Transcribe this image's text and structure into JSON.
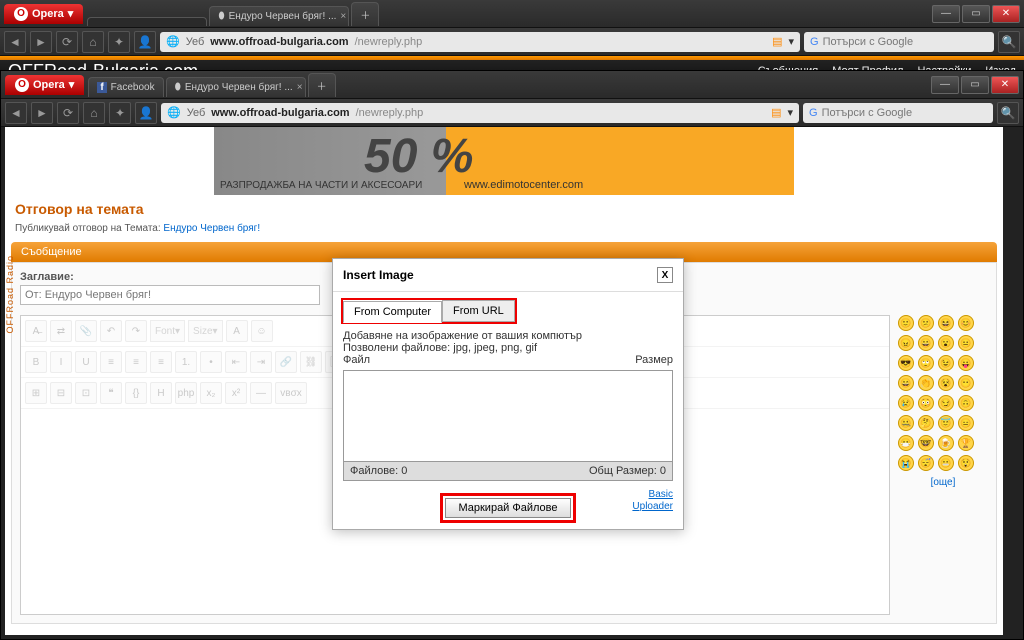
{
  "chrome": {
    "opera_label": "Opera",
    "tabs": [
      "",
      "Ендуро Червен бряг! ..."
    ],
    "addr_label": "Уеб",
    "domain": "www.offroad-bulgaria.com",
    "path": "/newreply.php",
    "search_placeholder": "Потърси с Google",
    "fb_tab": "Facebook"
  },
  "site": {
    "logo": "OFFRoad-Bulgaria.com",
    "nav": [
      "Съобщения",
      "Моят Профил",
      "Настройки",
      "Изход"
    ],
    "banner_pct": "50 %",
    "banner_txt1": "РАЗПРОДАЖБА НА ЧАСТИ И АКСЕСОАРИ",
    "banner_txt2": "www.edimotocenter.com"
  },
  "reply": {
    "heading": "Отговор на темата",
    "subtext_pre": "Публикувай отговор на Темата: ",
    "subtext_link": "Ендуро Червен бряг!",
    "msg_bar": "Съобщение",
    "title_label": "Заглавие:",
    "title_value": "От: Ендуро Червен бряг!",
    "more_smilies": "[още]",
    "side": "OFFRoad Radio"
  },
  "toolbar": {
    "font": "Font",
    "size": "Size",
    "a": "A",
    "b": "B",
    "i": "I",
    "u": "U"
  },
  "modal": {
    "title": "Insert Image",
    "tab1": "From Computer",
    "tab2": "From URL",
    "desc": "Добавяне на изображение от вашия компютър",
    "allowed": "Позволени файлове: jpg, jpeg, png, gif",
    "col_file": "Файл",
    "col_size": "Размер",
    "files_count": "Файлове: 0",
    "total_size": "Общ Размер: 0",
    "mark_btn": "Маркирай Файлове",
    "basic": "Basic",
    "uploader": "Uploader"
  }
}
